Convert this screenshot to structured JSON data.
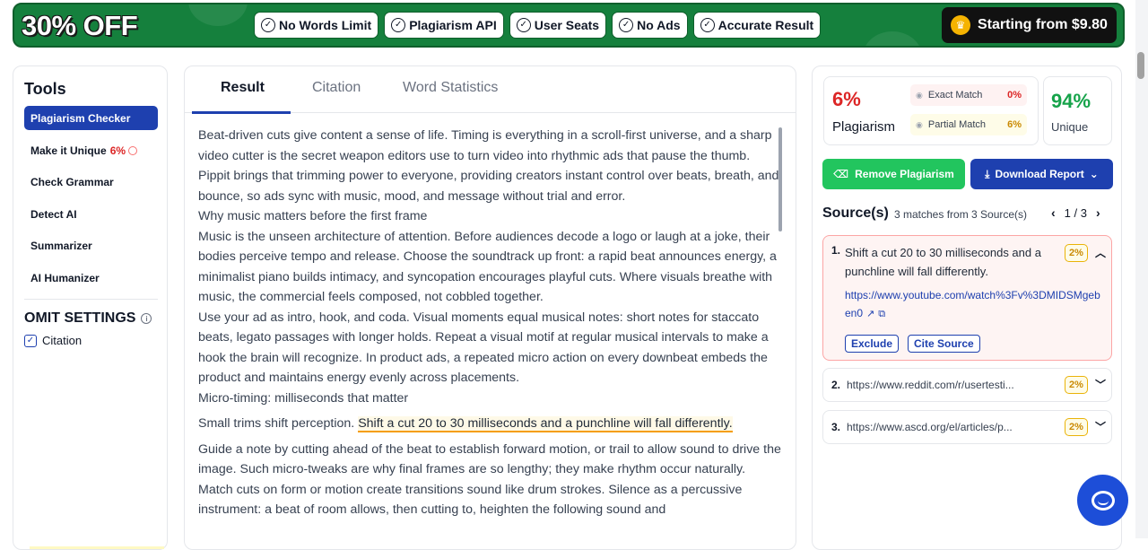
{
  "banner": {
    "promo": "30% OFF",
    "features": [
      "No Words Limit",
      "Plagiarism API",
      "User Seats",
      "No Ads",
      "Accurate Result"
    ],
    "cta": "Starting from $9.80"
  },
  "tools": {
    "title": "Tools",
    "items": [
      {
        "label": "Plagiarism Checker"
      },
      {
        "label": "Make it Unique",
        "pct": "6%"
      },
      {
        "label": "Check Grammar"
      },
      {
        "label": "Detect AI"
      },
      {
        "label": "Summarizer"
      },
      {
        "label": "AI Humanizer"
      }
    ],
    "omit_title": "OMIT SETTINGS",
    "citation_label": "Citation"
  },
  "result": {
    "tabs": [
      "Result",
      "Citation",
      "Word Statistics"
    ],
    "paragraphs": [
      "Beat-driven cuts give content a sense of life. Timing is everything in a scroll-first universe, and a sharp video cutter is the secret weapon editors use to turn video into rhythmic ads that pause the thumb. Pippit brings that trimming power to everyone, providing creators instant control over beats, breath, and bounce, so ads sync with music, mood, and message without trial and error.",
      "Why music matters before the first frame",
      "Music is the unseen architecture of attention. Before audiences decode a logo or laugh at a joke, their bodies perceive tempo and release. Choose the soundtrack up front: a rapid beat announces energy, a minimalist piano builds intimacy, and syncopation encourages playful cuts. Where visuals breathe with music, the commercial feels composed, not cobbled together.",
      "Use your ad as intro, hook, and coda. Visual moments equal musical notes: short notes for staccato beats, legato passages with longer holds. Repeat a visual motif at regular musical intervals to make a hook the brain will recognize. In product ads, a repeated micro action on every downbeat embeds the product and maintains energy evenly across placements.",
      "Micro-timing: milliseconds that matter"
    ],
    "highlight_pre": "Small trims shift perception. ",
    "highlight": "Shift a cut 20 to 30 milliseconds and a punchline will fall differently.",
    "after": "Guide a note by cutting ahead of the beat to establish forward motion, or trail to allow sound to drive the image. Such micro-tweaks are why final frames are so lengthy; they make rhythm occur naturally. Match cuts on form or motion create transitions sound like drum strokes. Silence as a percussive instrument: a beat of room allows, then cutting to, heighten the following sound and"
  },
  "scores": {
    "plagiarism_pct": "6%",
    "plagiarism_label": "Plagiarism",
    "exact_label": "Exact Match",
    "exact_pct": "0%",
    "partial_label": "Partial Match",
    "partial_pct": "6%",
    "unique_pct": "94%",
    "unique_label": "Unique",
    "plagiarism_color": "#dc2626",
    "unique_color": "#16a34a"
  },
  "actions": {
    "remove": "Remove Plagiarism",
    "download": "Download Report"
  },
  "sources": {
    "title": "Source(s)",
    "count": "3 matches from 3 Source(s)",
    "pager": "1 / 3",
    "items": [
      {
        "num": "1.",
        "text": "Shift a cut 20 to 30 milliseconds and a punchline will fall differently.",
        "url": "https://www.youtube.com/watch%3Fv%3DMIDSMgeben0",
        "pct": "2%",
        "exclude": "Exclude",
        "cite": "Cite Source"
      },
      {
        "num": "2.",
        "url": "https://www.reddit.com/r/usertesti...",
        "pct": "2%"
      },
      {
        "num": "3.",
        "url": "https://www.ascd.org/el/articles/p...",
        "pct": "2%"
      }
    ]
  }
}
